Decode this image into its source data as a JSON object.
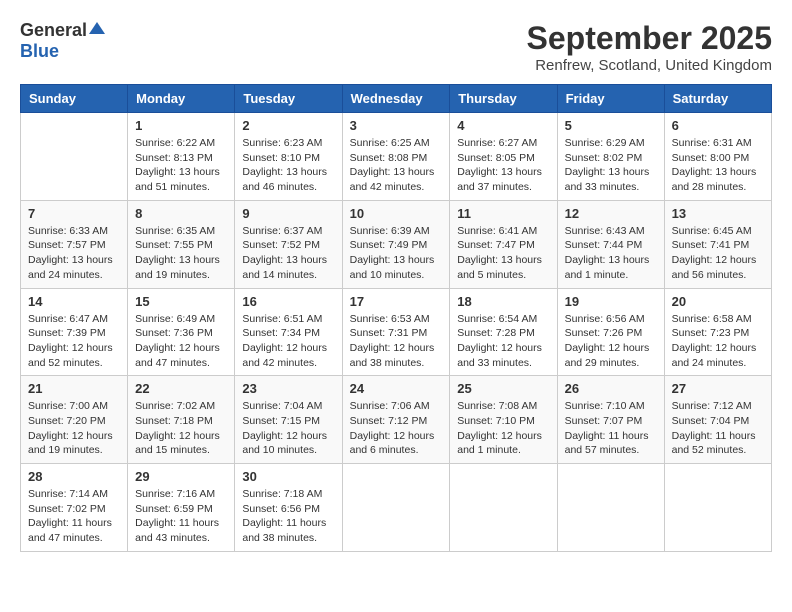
{
  "logo": {
    "general": "General",
    "blue": "Blue"
  },
  "title": "September 2025",
  "subtitle": "Renfrew, Scotland, United Kingdom",
  "days_of_week": [
    "Sunday",
    "Monday",
    "Tuesday",
    "Wednesday",
    "Thursday",
    "Friday",
    "Saturday"
  ],
  "weeks": [
    [
      {
        "day": "",
        "info": ""
      },
      {
        "day": "1",
        "info": "Sunrise: 6:22 AM\nSunset: 8:13 PM\nDaylight: 13 hours\nand 51 minutes."
      },
      {
        "day": "2",
        "info": "Sunrise: 6:23 AM\nSunset: 8:10 PM\nDaylight: 13 hours\nand 46 minutes."
      },
      {
        "day": "3",
        "info": "Sunrise: 6:25 AM\nSunset: 8:08 PM\nDaylight: 13 hours\nand 42 minutes."
      },
      {
        "day": "4",
        "info": "Sunrise: 6:27 AM\nSunset: 8:05 PM\nDaylight: 13 hours\nand 37 minutes."
      },
      {
        "day": "5",
        "info": "Sunrise: 6:29 AM\nSunset: 8:02 PM\nDaylight: 13 hours\nand 33 minutes."
      },
      {
        "day": "6",
        "info": "Sunrise: 6:31 AM\nSunset: 8:00 PM\nDaylight: 13 hours\nand 28 minutes."
      }
    ],
    [
      {
        "day": "7",
        "info": "Sunrise: 6:33 AM\nSunset: 7:57 PM\nDaylight: 13 hours\nand 24 minutes."
      },
      {
        "day": "8",
        "info": "Sunrise: 6:35 AM\nSunset: 7:55 PM\nDaylight: 13 hours\nand 19 minutes."
      },
      {
        "day": "9",
        "info": "Sunrise: 6:37 AM\nSunset: 7:52 PM\nDaylight: 13 hours\nand 14 minutes."
      },
      {
        "day": "10",
        "info": "Sunrise: 6:39 AM\nSunset: 7:49 PM\nDaylight: 13 hours\nand 10 minutes."
      },
      {
        "day": "11",
        "info": "Sunrise: 6:41 AM\nSunset: 7:47 PM\nDaylight: 13 hours\nand 5 minutes."
      },
      {
        "day": "12",
        "info": "Sunrise: 6:43 AM\nSunset: 7:44 PM\nDaylight: 13 hours\nand 1 minute."
      },
      {
        "day": "13",
        "info": "Sunrise: 6:45 AM\nSunset: 7:41 PM\nDaylight: 12 hours\nand 56 minutes."
      }
    ],
    [
      {
        "day": "14",
        "info": "Sunrise: 6:47 AM\nSunset: 7:39 PM\nDaylight: 12 hours\nand 52 minutes."
      },
      {
        "day": "15",
        "info": "Sunrise: 6:49 AM\nSunset: 7:36 PM\nDaylight: 12 hours\nand 47 minutes."
      },
      {
        "day": "16",
        "info": "Sunrise: 6:51 AM\nSunset: 7:34 PM\nDaylight: 12 hours\nand 42 minutes."
      },
      {
        "day": "17",
        "info": "Sunrise: 6:53 AM\nSunset: 7:31 PM\nDaylight: 12 hours\nand 38 minutes."
      },
      {
        "day": "18",
        "info": "Sunrise: 6:54 AM\nSunset: 7:28 PM\nDaylight: 12 hours\nand 33 minutes."
      },
      {
        "day": "19",
        "info": "Sunrise: 6:56 AM\nSunset: 7:26 PM\nDaylight: 12 hours\nand 29 minutes."
      },
      {
        "day": "20",
        "info": "Sunrise: 6:58 AM\nSunset: 7:23 PM\nDaylight: 12 hours\nand 24 minutes."
      }
    ],
    [
      {
        "day": "21",
        "info": "Sunrise: 7:00 AM\nSunset: 7:20 PM\nDaylight: 12 hours\nand 19 minutes."
      },
      {
        "day": "22",
        "info": "Sunrise: 7:02 AM\nSunset: 7:18 PM\nDaylight: 12 hours\nand 15 minutes."
      },
      {
        "day": "23",
        "info": "Sunrise: 7:04 AM\nSunset: 7:15 PM\nDaylight: 12 hours\nand 10 minutes."
      },
      {
        "day": "24",
        "info": "Sunrise: 7:06 AM\nSunset: 7:12 PM\nDaylight: 12 hours\nand 6 minutes."
      },
      {
        "day": "25",
        "info": "Sunrise: 7:08 AM\nSunset: 7:10 PM\nDaylight: 12 hours\nand 1 minute."
      },
      {
        "day": "26",
        "info": "Sunrise: 7:10 AM\nSunset: 7:07 PM\nDaylight: 11 hours\nand 57 minutes."
      },
      {
        "day": "27",
        "info": "Sunrise: 7:12 AM\nSunset: 7:04 PM\nDaylight: 11 hours\nand 52 minutes."
      }
    ],
    [
      {
        "day": "28",
        "info": "Sunrise: 7:14 AM\nSunset: 7:02 PM\nDaylight: 11 hours\nand 47 minutes."
      },
      {
        "day": "29",
        "info": "Sunrise: 7:16 AM\nSunset: 6:59 PM\nDaylight: 11 hours\nand 43 minutes."
      },
      {
        "day": "30",
        "info": "Sunrise: 7:18 AM\nSunset: 6:56 PM\nDaylight: 11 hours\nand 38 minutes."
      },
      {
        "day": "",
        "info": ""
      },
      {
        "day": "",
        "info": ""
      },
      {
        "day": "",
        "info": ""
      },
      {
        "day": "",
        "info": ""
      }
    ]
  ]
}
